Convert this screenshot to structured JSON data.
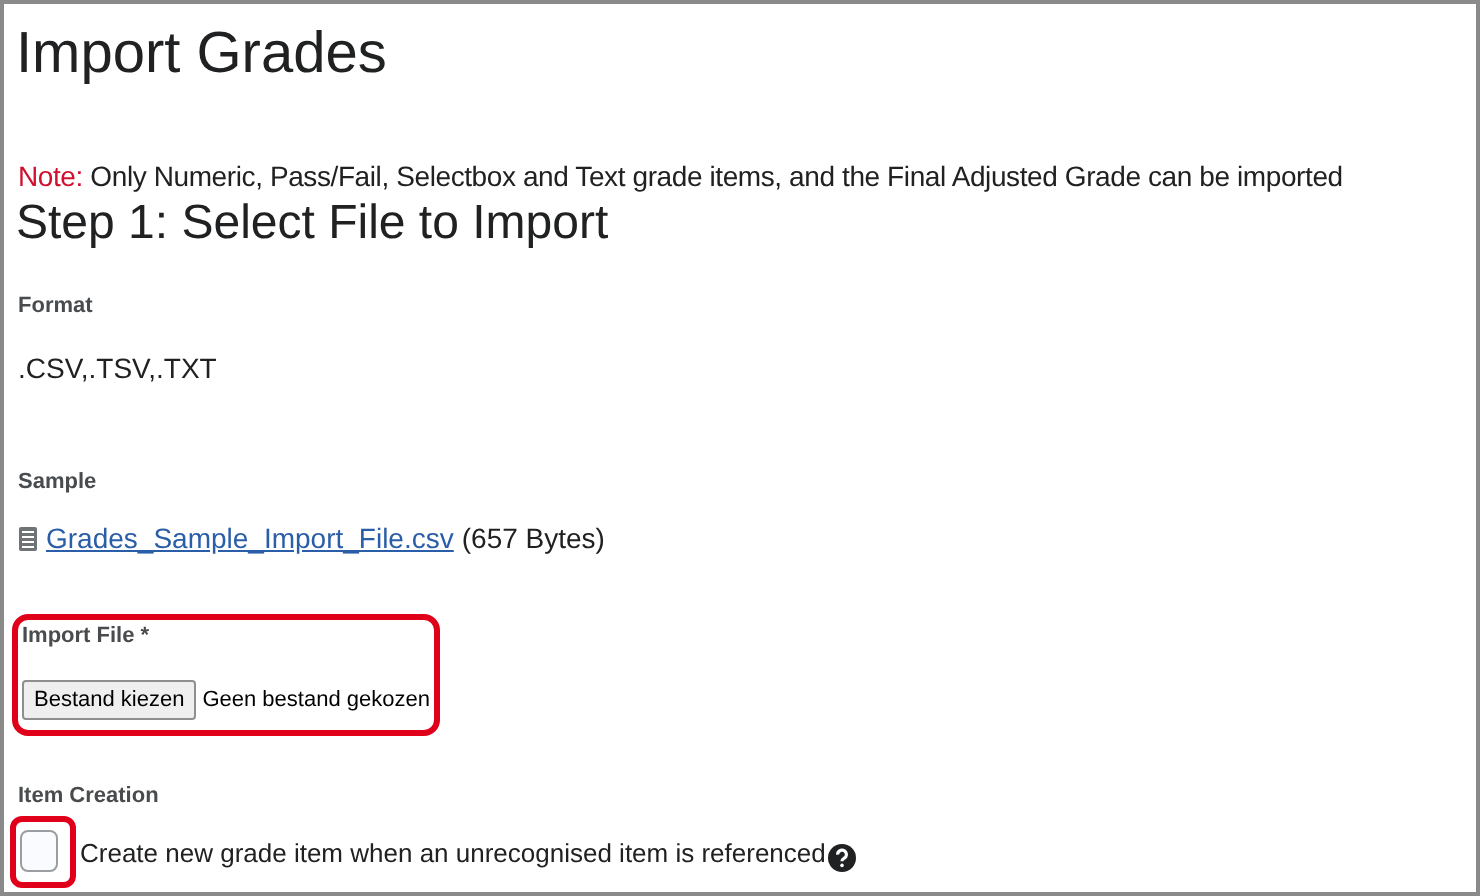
{
  "title": "Import Grades",
  "note": {
    "label": "Note:",
    "text": "Only Numeric, Pass/Fail, Selectbox and Text grade items, and the Final Adjusted Grade can be imported"
  },
  "step_heading": "Step 1: Select File to Import",
  "format": {
    "label": "Format",
    "value": ".CSV,.TSV,.TXT"
  },
  "sample": {
    "label": "Sample",
    "link": "Grades_Sample_Import_File.csv",
    "size": "(657 Bytes)"
  },
  "import_file": {
    "label": "Import File *",
    "button": "Bestand kiezen",
    "status": "Geen bestand gekozen"
  },
  "item_creation": {
    "label": "Item Creation",
    "checkbox_label": "Create new grade item when an unrecognised item is referenced",
    "checked": false
  }
}
